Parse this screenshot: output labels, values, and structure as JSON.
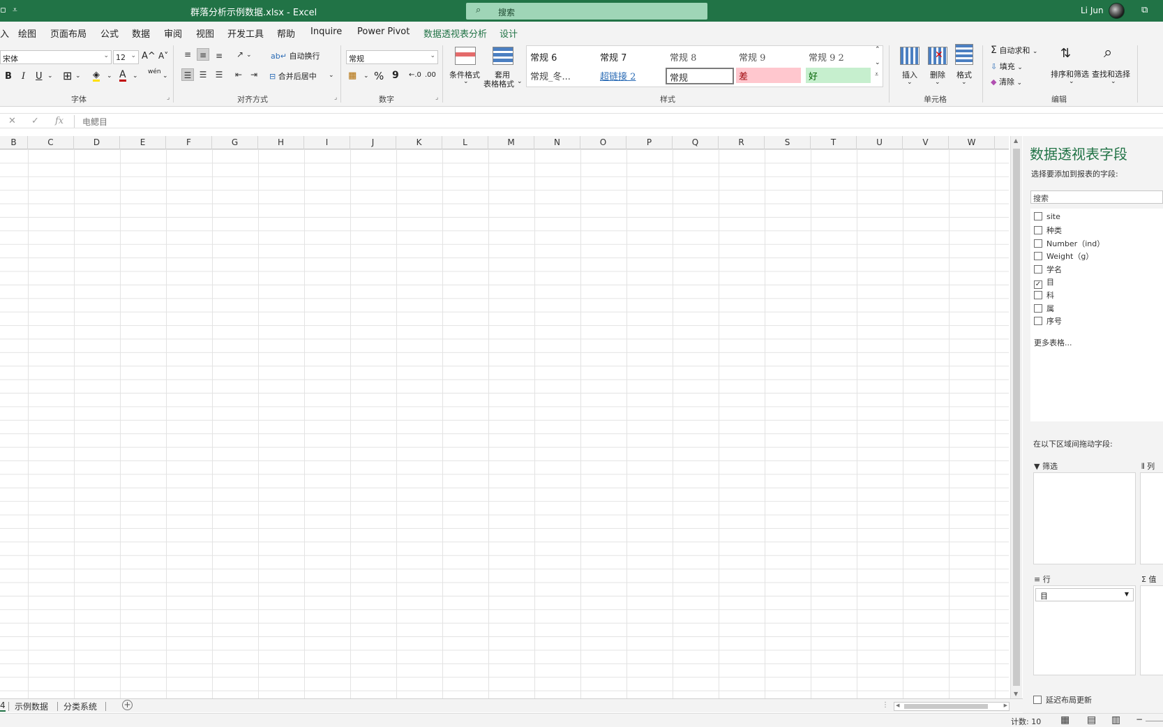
{
  "titlebar": {
    "window_icon": "▫",
    "quick_access": "⩡",
    "title": "群落分析示例数据.xlsx  -  Excel",
    "search_placeholder": "搜索",
    "user": "Li Jun",
    "colors": {
      "bar": "#217346",
      "search_bg": "#9fd5b7"
    }
  },
  "menu": {
    "tabs": [
      "绘图",
      "页面布局",
      "公式",
      "数据",
      "审阅",
      "视图",
      "开发工具",
      "帮助",
      "Inquire",
      "Power Pivot",
      "数据透视表分析",
      "设计"
    ],
    "cut_fragment": "入"
  },
  "ribbon": {
    "font": {
      "name": "宋体",
      "size": "12",
      "grow": "A^",
      "shrink": "A˅",
      "bold": "B",
      "italic": "I",
      "underline": "U",
      "phonetic": "wén",
      "label": "字体"
    },
    "alignment": {
      "wrap": "自动换行",
      "merge": "合并后居中",
      "label": "对齐方式"
    },
    "number": {
      "format": "常规",
      "percent": "%",
      "comma": "9",
      "inc_dec": "←.0",
      "dec_dec": ".00",
      "label": "数字"
    },
    "styles": {
      "cond_format": "条件格式",
      "table_format_1": "套用",
      "table_format_2": "表格格式",
      "cells": [
        "常规 6",
        "常规 7",
        "常规 8",
        "常规 9",
        "常规 9 2",
        "常规_冬...",
        "超链接 2",
        "常规",
        "差",
        "好"
      ],
      "label": "样式",
      "bad_bg": "#ffc7ce",
      "bad_fg": "#9c0006",
      "good_bg": "#c6efce",
      "good_fg": "#006100"
    },
    "cells_group": {
      "insert": "插入",
      "delete": "删除",
      "format": "格式",
      "label": "单元格"
    },
    "editing": {
      "autosum": "自动求和",
      "fill": "填充",
      "clear": "清除",
      "sort_filter": "排序和筛选",
      "find_select": "查找和选择",
      "label": "编辑"
    }
  },
  "formula_bar": {
    "cancel": "✕",
    "confirm": "✓",
    "fx": "fx",
    "content": "电鳃目"
  },
  "columns": [
    "B",
    "C",
    "D",
    "E",
    "F",
    "G",
    "H",
    "I",
    "J",
    "K",
    "L",
    "M",
    "N",
    "O",
    "P",
    "Q",
    "R",
    "S",
    "T",
    "U",
    "V",
    "W"
  ],
  "sheets": {
    "cut_fragment": "4",
    "tabs": [
      "示例数据",
      "分类系统"
    ],
    "add": "+"
  },
  "status": {
    "count": "计数: 10"
  },
  "pivot": {
    "title": "数据透视表字段",
    "subtitle": "选择要添加到报表的字段:",
    "search_placeholder": "搜索",
    "fields": [
      {
        "label": "site",
        "checked": false
      },
      {
        "label": "种类",
        "checked": false
      },
      {
        "label": "Number（ind）",
        "checked": false
      },
      {
        "label": "Weight（g）",
        "checked": false
      },
      {
        "label": "学名",
        "checked": false
      },
      {
        "label": "目",
        "checked": true
      },
      {
        "label": "科",
        "checked": false
      },
      {
        "label": "属",
        "checked": false
      },
      {
        "label": "序号",
        "checked": false
      }
    ],
    "more_tables": "更多表格...",
    "drag_hint": "在以下区域间拖动字段:",
    "areas": {
      "filter": "筛选",
      "columns": "列",
      "rows": "行",
      "values": "值",
      "row_item": "目"
    },
    "defer": "延迟布局更新"
  }
}
